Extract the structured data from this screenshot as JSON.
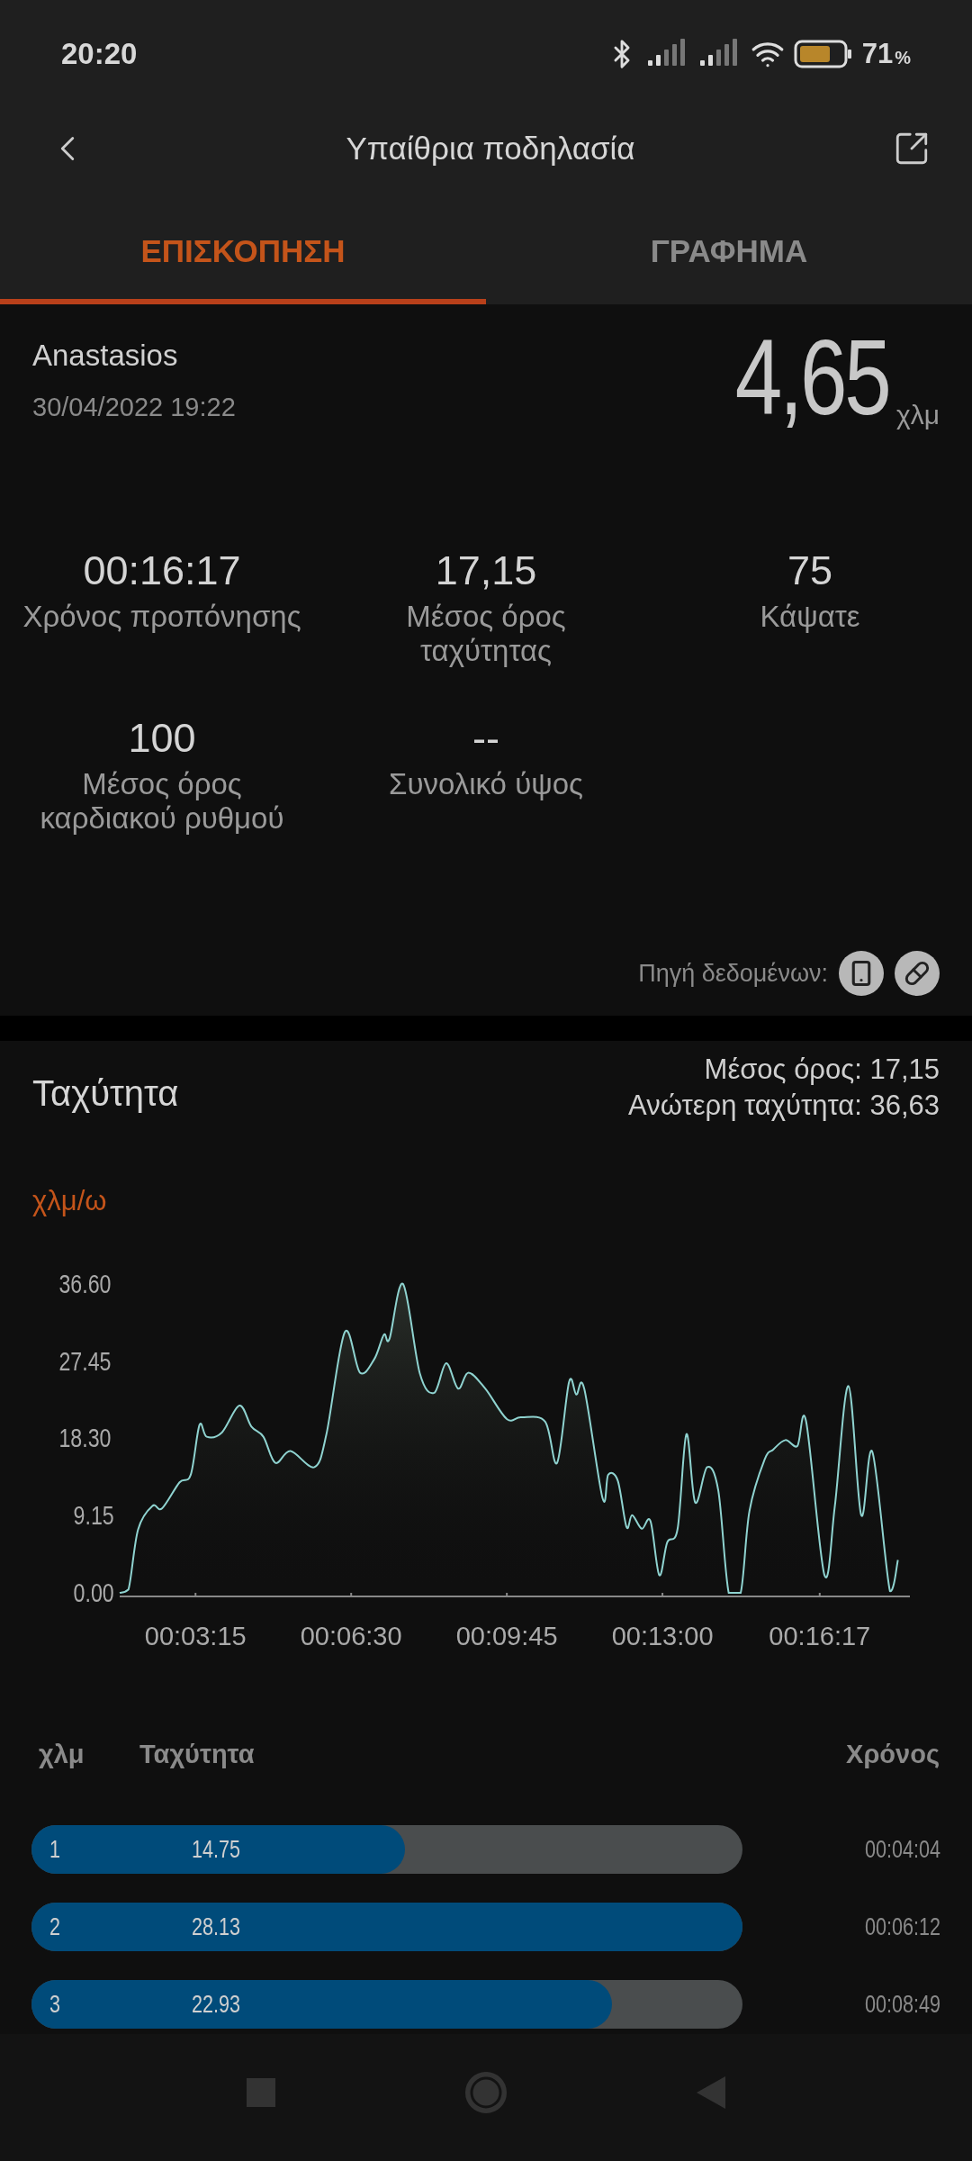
{
  "status_bar": {
    "time": "20:20",
    "battery": "71",
    "battery_unit": "%"
  },
  "header": {
    "title": "Υπαίθρια ποδηλασία"
  },
  "tabs": [
    {
      "label": "ΕΠΙΣΚΟΠΗΣΗ",
      "selected": true
    },
    {
      "label": "ΓΡΑΦΗΜΑ",
      "selected": false
    }
  ],
  "summary": {
    "user": "Anastasios",
    "date": "30/04/2022 19:22",
    "distance": "4,65",
    "distance_unit": "χλμ",
    "stats": [
      {
        "value": "00:16:17",
        "label": "Χρόνος προπόνησης"
      },
      {
        "value": "17,15",
        "label": "Μέσος όρος\nταχύτητας"
      },
      {
        "value": "75",
        "label": "Κάψατε"
      },
      {
        "value": "100",
        "label": "Μέσος όρος\nκαρδιακού ρυθμού"
      },
      {
        "value": "--",
        "label": "Συνολικό ύψος"
      }
    ],
    "data_source": "Πηγή δεδομένων:"
  },
  "speed": {
    "average": "Μέσος όρος: 17,15",
    "top_speed": "Ανώτερη ταχύτητα: 36,63",
    "chart_data": {
      "type": "line",
      "title": "Ταχύτητα",
      "ylabel": "χλμ/ω",
      "xlim": [
        100,
        1090
      ],
      "ylim": [
        0,
        36.6
      ],
      "yticks": [
        {
          "value": 0,
          "label": "0.00"
        },
        {
          "value": 9.15,
          "label": "9.15"
        },
        {
          "value": 18.3,
          "label": "18.30"
        },
        {
          "value": 27.45,
          "label": "27.45"
        },
        {
          "value": 36.6,
          "label": "36.60"
        }
      ],
      "xticks": [
        {
          "value": 195,
          "label": "00:03:15"
        },
        {
          "value": 390,
          "label": "00:06:30"
        },
        {
          "value": 585,
          "label": "00:09:45"
        },
        {
          "value": 780,
          "label": "00:13:00"
        },
        {
          "value": 977,
          "label": "00:16:17"
        }
      ],
      "x": [
        100,
        111,
        123,
        141,
        153,
        175,
        189,
        200,
        209,
        228,
        250,
        265,
        280,
        295,
        314,
        344,
        359,
        382,
        401,
        419,
        431,
        438,
        455,
        476,
        494,
        509,
        524,
        537,
        558,
        585,
        603,
        633,
        648,
        663,
        672,
        682,
        705,
        712,
        724,
        735,
        742,
        754,
        765,
        776,
        786,
        799,
        810,
        821,
        836,
        850,
        863,
        878,
        889,
        908,
        919,
        934,
        949,
        960,
        983,
        996,
        1013,
        1029,
        1043,
        1065,
        1075
      ],
      "series": [
        {
          "color": "#8fd3d0",
          "values": [
            0,
            0.4,
            7.5,
            10.3,
            10,
            13.1,
            14,
            19.9,
            18.5,
            19,
            22.2,
            19.7,
            18.5,
            15.4,
            16.8,
            14.9,
            18.8,
            30.9,
            26.1,
            27.7,
            30.6,
            30.1,
            36.6,
            26,
            23.7,
            27.2,
            24.2,
            26.1,
            24.2,
            20.6,
            20.8,
            20.3,
            15.4,
            25,
            23.5,
            24.2,
            11.2,
            14,
            13.3,
            7.8,
            9.2,
            7.6,
            8.5,
            2.1,
            6,
            7.6,
            18.8,
            10.7,
            14.9,
            12.1,
            0,
            0,
            9.7,
            15.8,
            17,
            18.1,
            17.4,
            20.3,
            2.1,
            10.3,
            24.5,
            9.2,
            16.7,
            0.2,
            3.9
          ]
        }
      ]
    }
  },
  "splits": {
    "columns": [
      "χλμ",
      "Ταχύτητα",
      "Χρόνος"
    ],
    "rows": [
      {
        "km": "1",
        "speed": "14.75",
        "level": 0.525,
        "time": "00:04:04"
      },
      {
        "km": "2",
        "speed": "28.13",
        "level": 1.0,
        "time": "00:06:12"
      },
      {
        "km": "3",
        "speed": "22.93",
        "level": 0.816,
        "time": "00:08:49"
      }
    ]
  }
}
